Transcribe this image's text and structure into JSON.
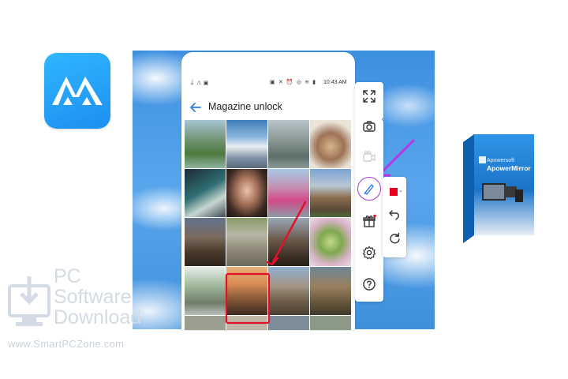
{
  "phone": {
    "status_time": "10:43 AM",
    "header_title": "Magazine unlock"
  },
  "toolbar": {
    "items": [
      {
        "name": "fullscreen",
        "icon": "expand-icon"
      },
      {
        "name": "screenshot",
        "icon": "camera-icon"
      },
      {
        "name": "record",
        "icon": "video-camera-icon"
      },
      {
        "name": "whiteboard",
        "icon": "pen-icon"
      },
      {
        "name": "gift",
        "icon": "gift-icon"
      },
      {
        "name": "settings",
        "icon": "gear-icon"
      },
      {
        "name": "help",
        "icon": "help-icon"
      }
    ],
    "pen_color": "#e6001e",
    "active_tool_color": "#a43be0"
  },
  "product_box": {
    "brand": "Apowersoft",
    "title": "ApowerMirror"
  },
  "watermark": {
    "line1": "PC",
    "line2": "Software",
    "line3": "Download",
    "url": "www.SmartPCZone.com"
  },
  "colors": {
    "logo_blue": "#1d8ff0",
    "annotation_red": "#e3102a",
    "annotation_purple": "#b438e4"
  }
}
